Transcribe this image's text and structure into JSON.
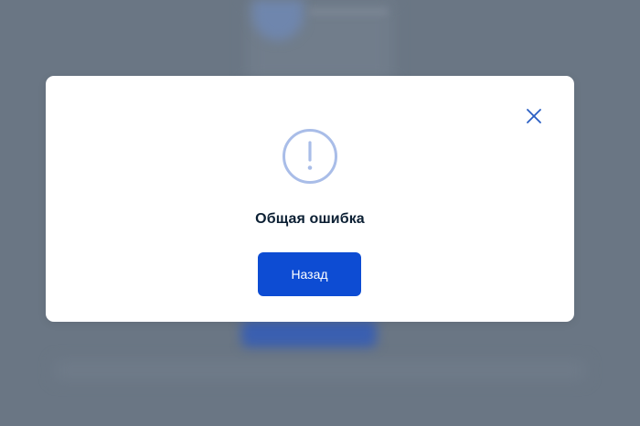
{
  "colors": {
    "overlay": "#6b7785",
    "modal_bg": "#ffffff",
    "accent": "#0d4cd3",
    "icon_stroke": "#a9bde8",
    "close_icon": "#2b5fc4",
    "title_text": "#0b1f33"
  },
  "dialog": {
    "icon": "exclamation-circle-icon",
    "close_icon": "close-icon",
    "title": "Общая ошибка",
    "button_label": "Назад"
  }
}
